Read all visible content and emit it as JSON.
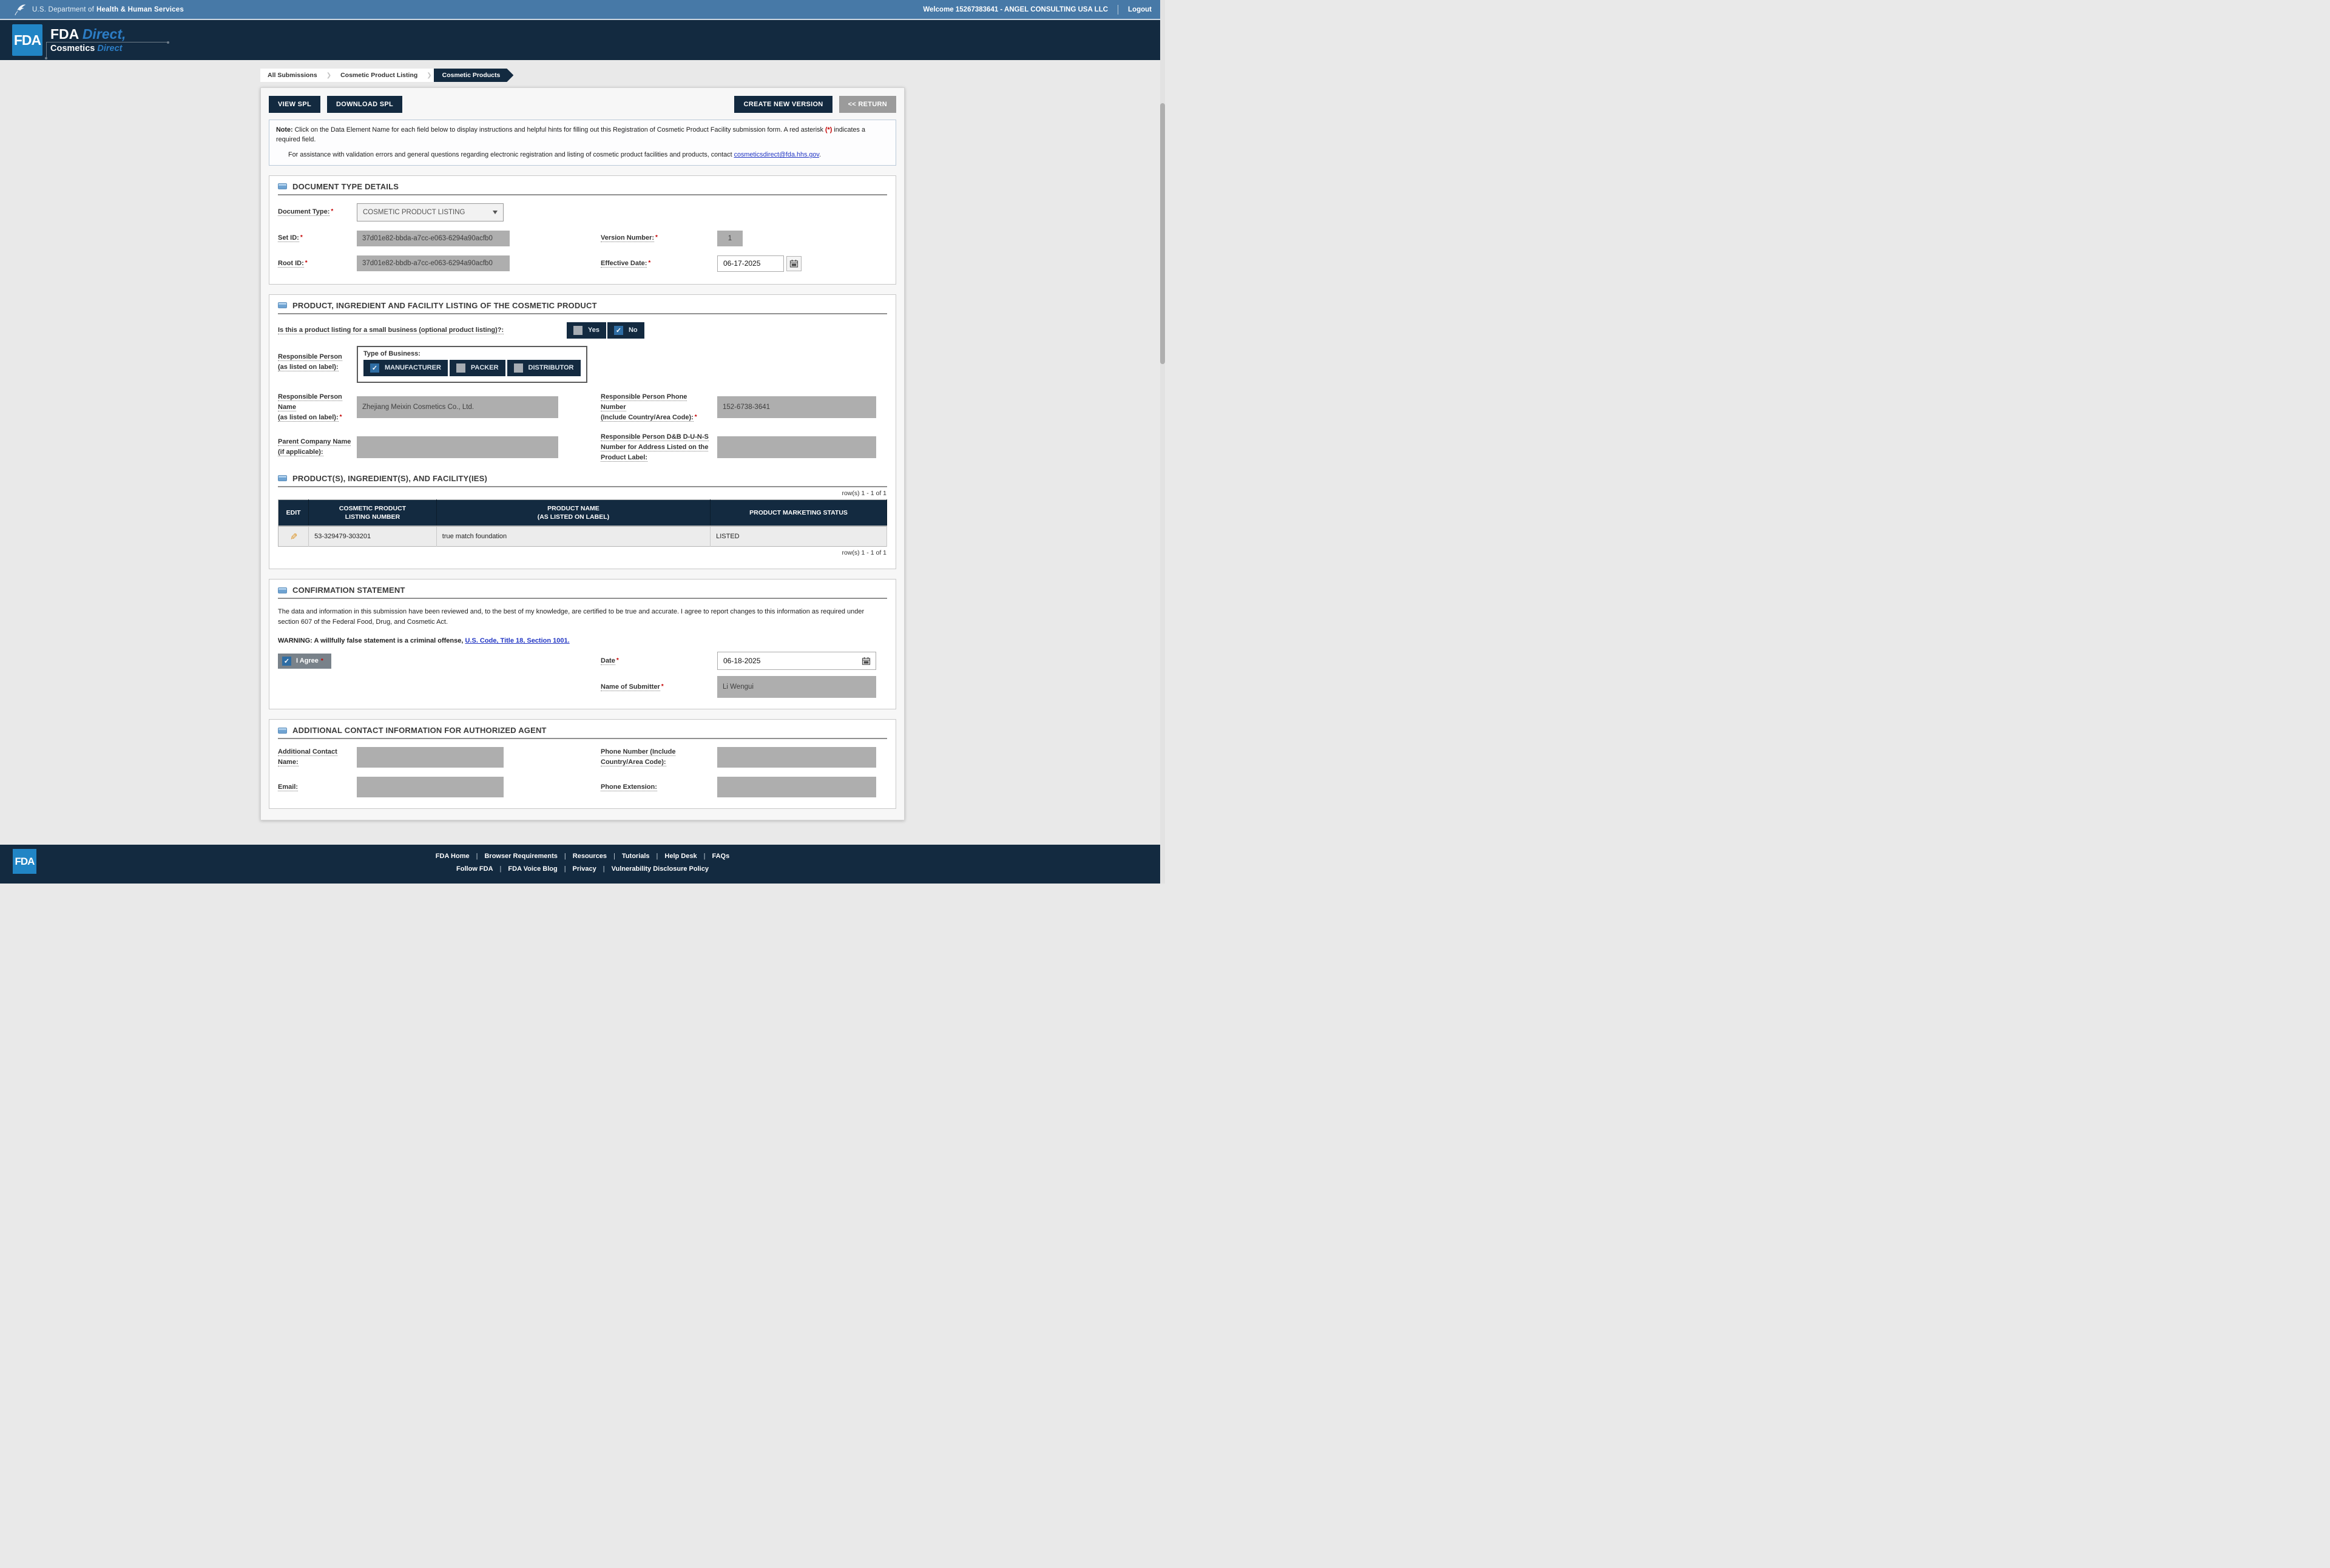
{
  "topbar": {
    "agency_prefix": "U.S. Department of",
    "agency_bold": "Health & Human Services",
    "welcome": "Welcome 15267383641 - ANGEL CONSULTING USA LLC",
    "logout": "Logout"
  },
  "brand": {
    "logo_text": "FDA",
    "line1_bold": "FDA",
    "line1_italic": "Direct,",
    "line2_bold": "Cosmetics",
    "line2_italic": "Direct"
  },
  "breadcrumbs": [
    {
      "label": "All Submissions",
      "active": false
    },
    {
      "label": "Cosmetic Product Listing",
      "active": false
    },
    {
      "label": "Cosmetic Products",
      "active": true
    }
  ],
  "toolbar": {
    "view_spl": "VIEW SPL",
    "download_spl": "DOWNLOAD SPL",
    "create_new_version": "CREATE NEW VERSION",
    "return": "<< RETURN"
  },
  "note": {
    "label": "Note:",
    "text_1": "Click on the Data Element Name for each field below to display instructions and helpful hints for filling out this Registration of Cosmetic Product Facility submission form. A red asterisk",
    "star": "(*)",
    "text_2": "indicates a required field.",
    "assist_text": "For assistance with validation errors and general questions regarding electronic registration and listing of cosmetic product facilities and products, contact",
    "assist_link": "cosmeticsdirect@fda.hhs.gov",
    "assist_suffix": "."
  },
  "doc_section": {
    "title": "DOCUMENT TYPE DETAILS",
    "document_type_label": "Document Type:",
    "document_type_value": "COSMETIC PRODUCT LISTING",
    "set_id_label": "Set ID:",
    "set_id_value": "37d01e82-bbda-a7cc-e063-6294a90acfb0",
    "version_label": "Version Number:",
    "version_value": "1",
    "root_id_label": "Root ID:",
    "root_id_value": "37d01e82-bbdb-a7cc-e063-6294a90acfb0",
    "effective_date_label": "Effective Date:",
    "effective_date_value": "06-17-2025"
  },
  "product_section": {
    "title": "PRODUCT, INGREDIENT AND FACILITY LISTING OF THE COSMETIC PRODUCT",
    "small_business_label": "Is this a product listing for a small business (optional product listing)?:",
    "yes_label": "Yes",
    "no_label": "No",
    "yes_checked": false,
    "no_checked": true,
    "rp_label": "Responsible Person (as listed on label):",
    "type_of_business_label": "Type of Business:",
    "business_types": [
      {
        "label": "MANUFACTURER",
        "checked": true
      },
      {
        "label": "PACKER",
        "checked": false
      },
      {
        "label": "DISTRIBUTOR",
        "checked": false
      }
    ],
    "rp_name_label": "Responsible Person Name",
    "rp_name_sublabel": "(as listed on label):",
    "rp_name_value": "Zhejiang Meixin Cosmetics Co., Ltd.",
    "rp_phone_label": "Responsible Person Phone Number",
    "rp_phone_sublabel": "(Include Country/Area Code):",
    "rp_phone_value": "152-6738-3641",
    "parent_company_label": "Parent Company Name",
    "parent_company_sublabel": "(if applicable):",
    "parent_company_value": "",
    "duns_label": "Responsible Person D&B D-U-N-S Number for Address Listed on the Product Label:",
    "duns_value": ""
  },
  "products_subsection": {
    "title": "PRODUCT(S), INGREDIENT(S), AND FACILITY(IES)",
    "row_count": "row(s) 1 - 1 of 1",
    "table": {
      "headers": [
        "EDIT",
        "COSMETIC PRODUCT\nLISTING NUMBER",
        "PRODUCT NAME\n(AS LISTED ON LABEL)",
        "PRODUCT MARKETING STATUS"
      ],
      "rows": [
        {
          "listing_number": "53-329479-303201",
          "product_name": "true match foundation",
          "status": "LISTED"
        }
      ]
    }
  },
  "confirmation_section": {
    "title": "CONFIRMATION STATEMENT",
    "statement": "The data and information in this submission have been reviewed and, to the best of my knowledge, are certified to be true and accurate. I agree to report changes to this information as required under section 607 of the Federal Food, Drug, and Cosmetic Act.",
    "warning_prefix": "WARNING: A willfully false statement is a criminal offense,",
    "warning_link": "U.S. Code, Title 18, Section 1001.",
    "i_agree_label": "I Agree",
    "i_agree_checked": true,
    "date_label": "Date",
    "date_value": "06-18-2025",
    "submitter_label": "Name of Submitter",
    "submitter_value": "Li Wengui"
  },
  "additional_section": {
    "title": "ADDITIONAL CONTACT INFORMATION FOR AUTHORIZED AGENT",
    "contact_name_label": "Additional Contact Name:",
    "contact_name_value": "",
    "phone_label": "Phone Number (Include Country/Area Code):",
    "phone_value": "",
    "email_label": "Email:",
    "email_value": "",
    "phone_ext_label": "Phone Extension:",
    "phone_ext_value": ""
  },
  "footer": {
    "logo_text": "FDA",
    "links_row1": [
      "FDA Home",
      "Browser Requirements",
      "Resources",
      "Tutorials",
      "Help Desk",
      "FAQs"
    ],
    "links_row2": [
      "Follow FDA",
      "FDA Voice Blog",
      "Privacy",
      "Vulnerability Disclosure Policy"
    ]
  },
  "icons": {
    "check": "✓",
    "chevron": "❯",
    "edit_pencil": "✎"
  },
  "misc": {
    "required_marker": "*"
  },
  "colors": {
    "topbar_blue": "#4779A7",
    "navy": "#132A40",
    "fda_blue": "#2185C5",
    "link_blue": "#2337C4",
    "checked_blue": "#2E6DA4",
    "required_red": "#C40000",
    "readonly_gray": "#AEAEAE"
  }
}
